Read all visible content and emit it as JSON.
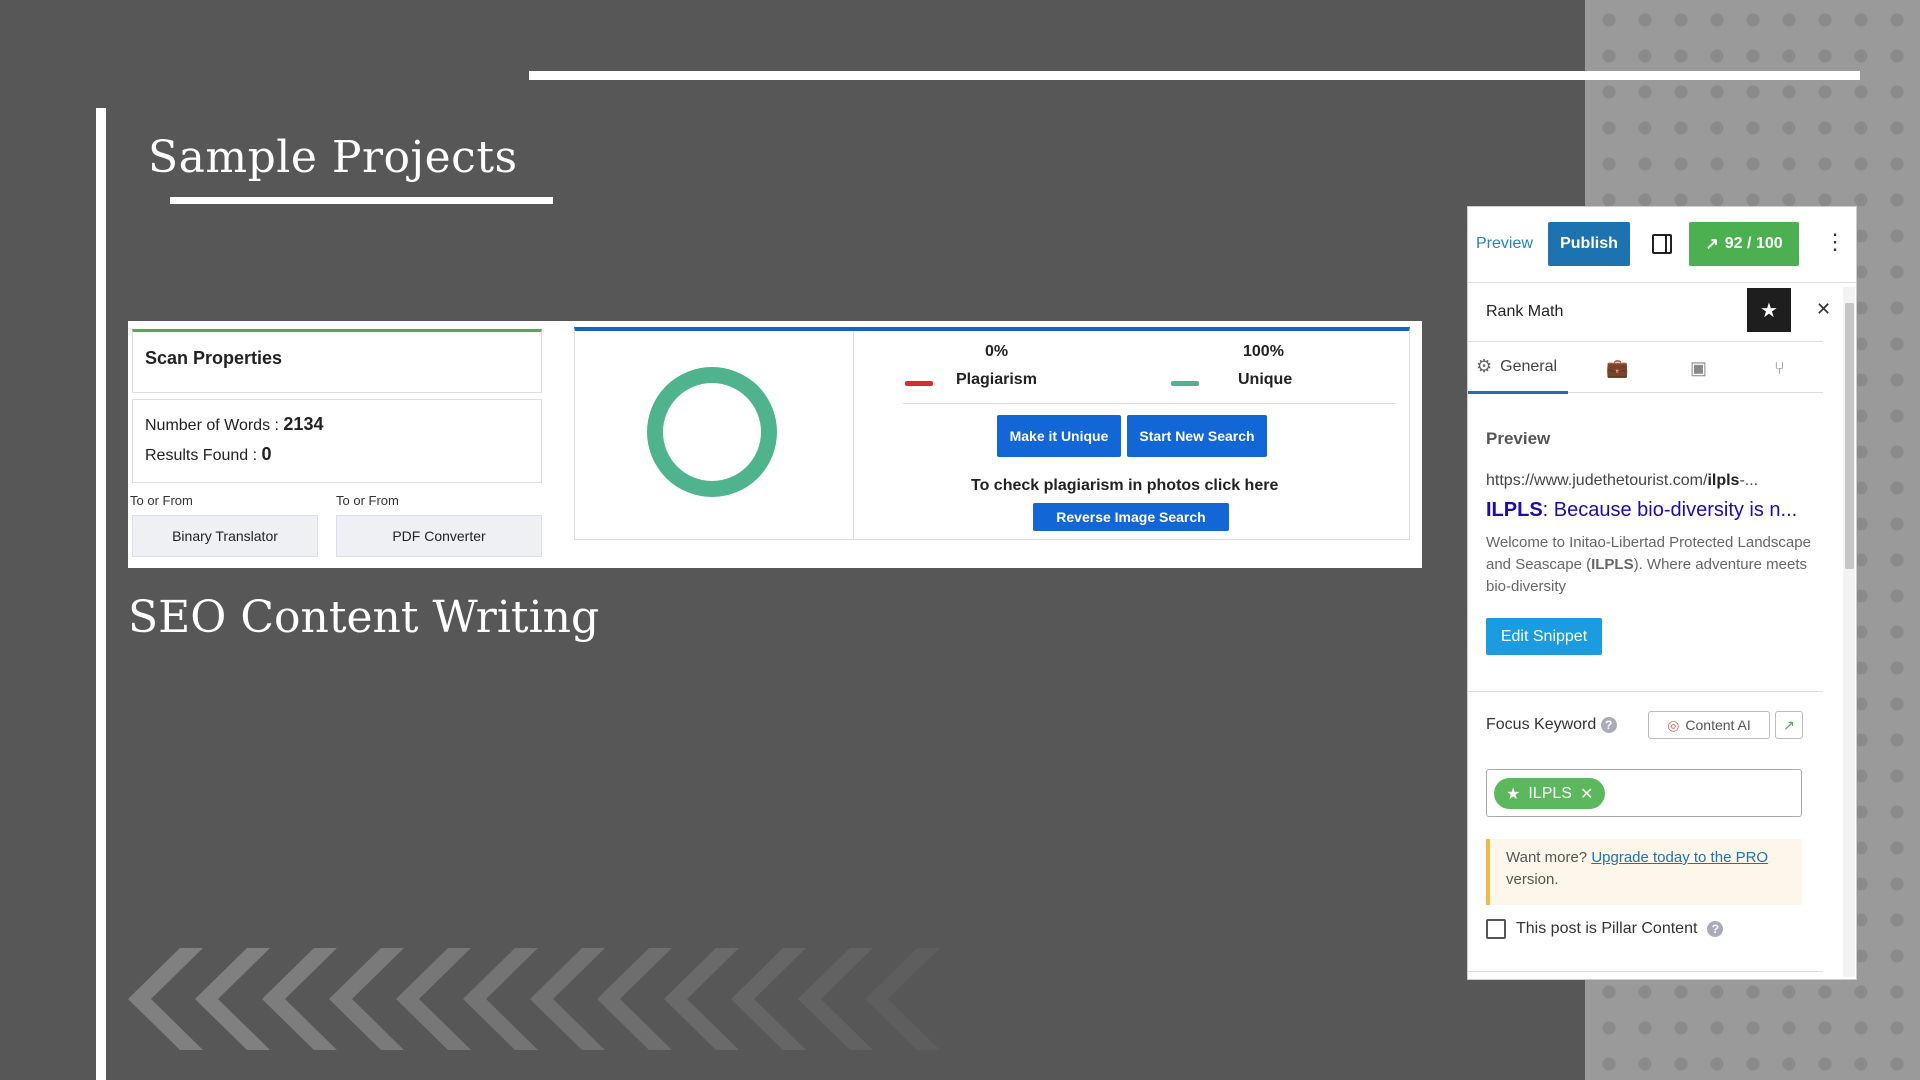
{
  "slide": {
    "title": "Sample Projects",
    "subtitle": "SEO Content Writing"
  },
  "scan": {
    "properties_title": "Scan Properties",
    "words_label": "Number of Words :",
    "words_value": "2134",
    "results_label": "Results Found :",
    "results_value": "0",
    "to_from_1": "To or From",
    "to_from_2": "To or From",
    "converter_1": "Binary Translator",
    "converter_2": "PDF Converter",
    "plagiarism_pct": "0%",
    "unique_pct": "100%",
    "plagiarism_label": "Plagiarism",
    "unique_label": "Unique",
    "make_unique_btn": "Make it Unique",
    "new_search_btn": "Start New Search",
    "check_photos_text": "To check plagiarism in photos click here",
    "reverse_image_btn": "Reverse Image Search",
    "colors": {
      "plagiarism": "#d32f2f",
      "unique": "#4fb48e",
      "button": "#1266d6"
    }
  },
  "rankmath": {
    "preview_link": "Preview",
    "publish_btn": "Publish",
    "score": "92 / 100",
    "panel_title": "Rank Math",
    "tab_general": "General",
    "preview_heading": "Preview",
    "url_prefix": "https://www.judethetourist.com/",
    "url_bold": "ilpls",
    "url_suffix": "-...",
    "snippet_title_bold": "ILPLS",
    "snippet_title_rest": ": Because bio-diversity is n...",
    "desc_1": "Welcome to Initao-Libertad Protected Landscape and Seascape (",
    "desc_bold": "ILPLS",
    "desc_2": "). Where adventure meets bio-diversity",
    "edit_snippet_btn": "Edit Snippet",
    "focus_keyword_label": "Focus Keyword",
    "content_ai_btn": "Content AI",
    "keyword_tag": "ILPLS",
    "upgrade_pre": "Want more? ",
    "upgrade_link": "Upgrade today to the PRO",
    "upgrade_post": " version.",
    "pillar_label": "This post is Pillar Content",
    "colors": {
      "publish": "#1c73b0",
      "score": "#4caf50",
      "snippet_title": "#1a0dab"
    }
  }
}
